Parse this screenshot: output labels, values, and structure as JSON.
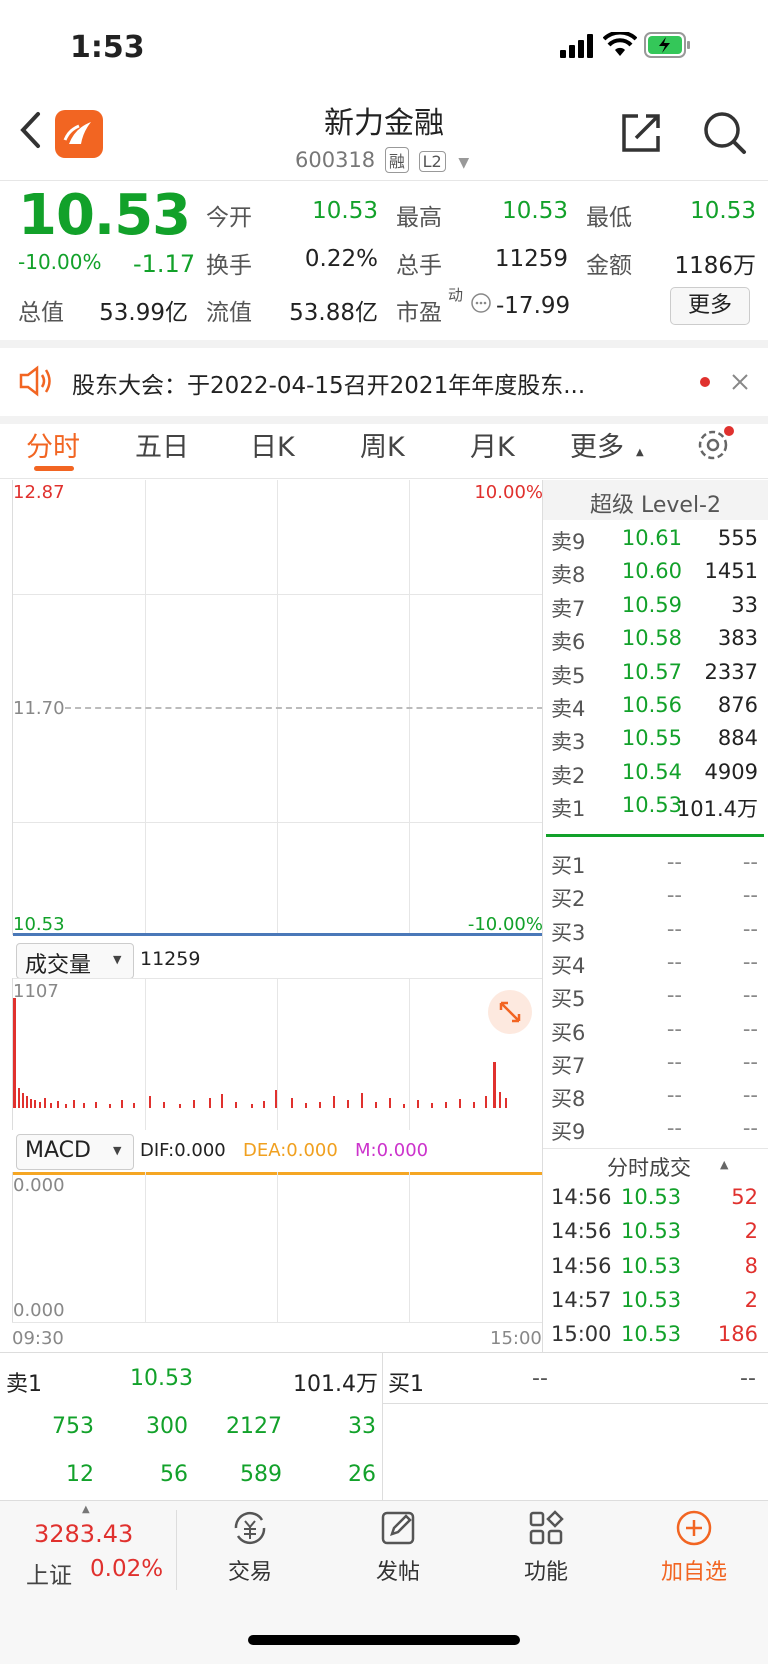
{
  "status": {
    "time": "1:53"
  },
  "header": {
    "title": "新力金融",
    "code": "600318",
    "tag1": "融",
    "tag2": "L2"
  },
  "quote": {
    "price": "10.53",
    "change_pct": "-10.00%",
    "change": "-1.17",
    "open_label": "今开",
    "open": "10.53",
    "high_label": "最高",
    "high": "10.53",
    "low_label": "最低",
    "low": "10.53",
    "turnover_label": "换手",
    "turnover": "0.22%",
    "volume_label": "总手",
    "volume": "11259",
    "amount_label": "金额",
    "amount": "1186万",
    "mcap_label": "总值",
    "mcap": "53.99亿",
    "float_label": "流值",
    "float": "53.88亿",
    "pe_label": "市盈",
    "pe_sup": "动",
    "pe": "-17.99",
    "more_label": "更多"
  },
  "notice": {
    "text": "股东大会：于2022-04-15召开2021年年度股东..."
  },
  "tabs": [
    "分时",
    "五日",
    "日K",
    "周K",
    "月K",
    "更多"
  ],
  "chart": {
    "price_top": "12.87",
    "pct_top": "10.00%",
    "price_mid": "11.70",
    "price_bottom": "10.53",
    "pct_bottom": "-10.00%",
    "vol_label": "成交量",
    "vol_value": "11259",
    "vol_max": "1107",
    "macd_label": "MACD",
    "dif": "DIF:0.000",
    "dea": "DEA:0.000",
    "m": "M:0.000",
    "macd_top": "0.000",
    "macd_bottom": "0.000",
    "time_start": "09:30",
    "time_end": "15:00"
  },
  "level2": {
    "title": "超级 Level-2",
    "asks": [
      {
        "label": "卖9",
        "price": "10.61",
        "vol": "555"
      },
      {
        "label": "卖8",
        "price": "10.60",
        "vol": "1451"
      },
      {
        "label": "卖7",
        "price": "10.59",
        "vol": "33"
      },
      {
        "label": "卖6",
        "price": "10.58",
        "vol": "383"
      },
      {
        "label": "卖5",
        "price": "10.57",
        "vol": "2337"
      },
      {
        "label": "卖4",
        "price": "10.56",
        "vol": "876"
      },
      {
        "label": "卖3",
        "price": "10.55",
        "vol": "884"
      },
      {
        "label": "卖2",
        "price": "10.54",
        "vol": "4909"
      },
      {
        "label": "卖1",
        "price": "10.53",
        "vol": "101.4万"
      }
    ],
    "bids": [
      {
        "label": "买1",
        "price": "--",
        "vol": "--"
      },
      {
        "label": "买2",
        "price": "--",
        "vol": "--"
      },
      {
        "label": "买3",
        "price": "--",
        "vol": "--"
      },
      {
        "label": "买4",
        "price": "--",
        "vol": "--"
      },
      {
        "label": "买5",
        "price": "--",
        "vol": "--"
      },
      {
        "label": "买6",
        "price": "--",
        "vol": "--"
      },
      {
        "label": "买7",
        "price": "--",
        "vol": "--"
      },
      {
        "label": "买8",
        "price": "--",
        "vol": "--"
      },
      {
        "label": "买9",
        "price": "--",
        "vol": "--"
      }
    ],
    "ticks_title": "分时成交",
    "ticks": [
      {
        "time": "14:56",
        "price": "10.53",
        "vol": "52"
      },
      {
        "time": "14:56",
        "price": "10.53",
        "vol": "2"
      },
      {
        "time": "14:56",
        "price": "10.53",
        "vol": "8"
      },
      {
        "time": "14:57",
        "price": "10.53",
        "vol": "2"
      },
      {
        "time": "15:00",
        "price": "10.53",
        "vol": "186"
      }
    ]
  },
  "bottom": {
    "sell_label": "卖1",
    "sell_price": "10.53",
    "sell_vol": "101.4万",
    "buy_label": "买1",
    "buy_price": "--",
    "buy_vol": "--",
    "row1": [
      "753",
      "300",
      "2127",
      "33"
    ],
    "row2": [
      "12",
      "56",
      "589",
      "26"
    ]
  },
  "nav": {
    "index_value": "3283.43",
    "index_name": "上证",
    "index_pct": "0.02%",
    "items": [
      "交易",
      "发帖",
      "功能",
      "加自选"
    ]
  },
  "colors": {
    "accent": "#f26522",
    "up": "#e0312e",
    "down": "#12a12a"
  }
}
